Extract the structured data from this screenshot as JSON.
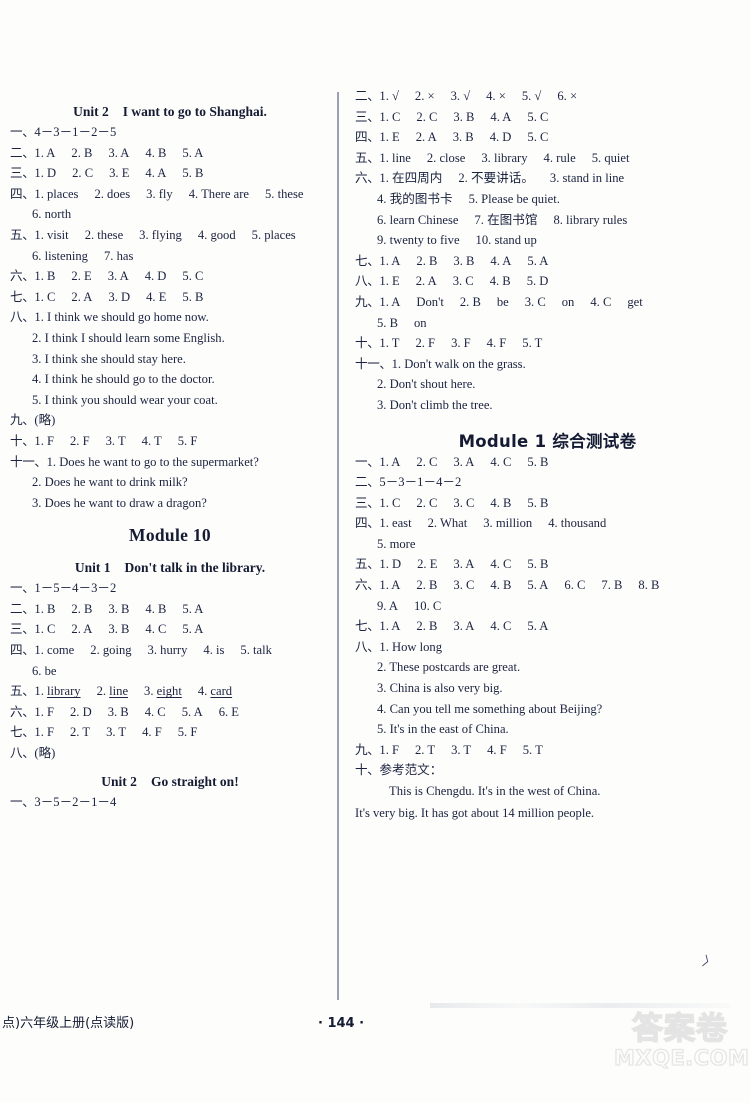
{
  "page": {
    "number": "· 144 ·",
    "footer_note": "点)六年级上册(点读版)",
    "watermark_cjk": "答案卷",
    "watermark_domain": "MXQE.COM",
    "edge_mark": "〉"
  },
  "left_column": {
    "unit2_title_num": "Unit 2",
    "unit2_title_text": "I want to go to Shanghai.",
    "unit2_answers": [
      {
        "idx": "一、",
        "body": "4－3－1－2－5"
      },
      {
        "idx": "二、",
        "body": "1. A   2. B   3. A   4. B   5. A"
      },
      {
        "idx": "三、",
        "body": "1. D   2. C   3. E   4. A   5. B"
      },
      {
        "idx": "四、",
        "body": "1. places   2. does   3. fly   4. There are   5. these"
      },
      {
        "idx": "",
        "body": "6. north",
        "continuation": true
      },
      {
        "idx": "五、",
        "body": "1. visit   2. these   3. flying   4. good   5. places"
      },
      {
        "idx": "",
        "body": "6. listening   7. has",
        "continuation": true
      },
      {
        "idx": "六、",
        "body": "1. B   2. E   3. A   4. D   5. C"
      },
      {
        "idx": "七、",
        "body": "1. C   2. A   3. D   4. E   5. B"
      },
      {
        "idx": "八、",
        "body": "1. I think we should go home now."
      },
      {
        "idx": "",
        "body": "2. I think I should learn some English.",
        "continuation": true
      },
      {
        "idx": "",
        "body": "3. I think she should stay here.",
        "continuation": true
      },
      {
        "idx": "",
        "body": "4. I think he should go to the doctor.",
        "continuation": true
      },
      {
        "idx": "",
        "body": "5. I think you should wear your coat.",
        "continuation": true
      },
      {
        "idx": "九、",
        "body": "(略)"
      },
      {
        "idx": "十、",
        "body": "1. F   2. F   3. T   4. T   5. F"
      },
      {
        "idx": "十一、",
        "body": "1. Does he want to go to the supermarket?"
      },
      {
        "idx": "",
        "body": "2. Does he want to drink milk?",
        "continuation": true
      },
      {
        "idx": "",
        "body": "3. Does he want to draw a dragon?",
        "continuation": true
      }
    ],
    "module10_title": "Module 10",
    "unit1_title_num": "Unit 1",
    "unit1_title_text": "Don't talk in the library.",
    "unit1_answers": [
      {
        "idx": "一、",
        "body": "1－5－4－3－2"
      },
      {
        "idx": "二、",
        "body": "1. B   2. B   3. B   4. B   5. A"
      },
      {
        "idx": "三、",
        "body": "1. C   2. A   3. B   4. C   5. A"
      },
      {
        "idx": "四、",
        "body": "1. come   2. going   3. hurry   4. is   5. talk"
      },
      {
        "idx": "",
        "body": "6. be",
        "continuation": true
      },
      {
        "idx": "五、",
        "body": "1. library   2. line   3. eight   4. card",
        "underlined": true
      },
      {
        "idx": "六、",
        "body": "1. F   2. D   3. B   4. C   5. A   6. E"
      },
      {
        "idx": "七、",
        "body": "1. F   2. T   3. T   4. F   5. F"
      },
      {
        "idx": "八、",
        "body": "(略)"
      }
    ],
    "unit2b_title_num": "Unit 2",
    "unit2b_title_text": "Go straight on!",
    "unit2b_answers": [
      {
        "idx": "一、",
        "body": "3－5－2－1－4"
      }
    ]
  },
  "right_column": {
    "unit2b_answers_cont": [
      {
        "idx": "二、",
        "body": "1. √   2. ×   3. √   4. ×   5. √   6. ×"
      },
      {
        "idx": "三、",
        "body": "1. C   2. C   3. B   4. A   5. C"
      },
      {
        "idx": "四、",
        "body": "1. E   2. A   3. B   4. D   5. C"
      },
      {
        "idx": "五、",
        "body": "1. line   2. close   3. library   4. rule   5. quiet"
      },
      {
        "idx": "六、",
        "body": "1. 在四周内   2. 不要讲话。   3. stand in line"
      },
      {
        "idx": "",
        "body": "4. 我的图书卡   5. Please be quiet.",
        "continuation": true
      },
      {
        "idx": "",
        "body": "6. learn Chinese   7. 在图书馆   8. library rules",
        "continuation": true
      },
      {
        "idx": "",
        "body": "9. twenty to five   10. stand up",
        "continuation": true
      },
      {
        "idx": "七、",
        "body": "1. A   2. B   3. B   4. A   5. A"
      },
      {
        "idx": "八、",
        "body": "1. E   2. A   3. C   4. B   5. D"
      },
      {
        "idx": "九、",
        "body": "1. A   Don't   2. B   be   3. C   on   4. C   get"
      },
      {
        "idx": "",
        "body": "5. B   on",
        "continuation": true
      },
      {
        "idx": "十、",
        "body": "1. T   2. F   3. F   4. F   5. T"
      },
      {
        "idx": "十一、",
        "body": "1. Don't walk on the grass."
      },
      {
        "idx": "",
        "body": "2. Don't shout here.",
        "continuation": true
      },
      {
        "idx": "",
        "body": "3. Don't climb the tree.",
        "continuation": true
      }
    ],
    "module1_title": "Module 1 综合测试卷",
    "module1_answers": [
      {
        "idx": "一、",
        "body": "1. A   2. C   3. A   4. C   5. B"
      },
      {
        "idx": "二、",
        "body": "5－3－1－4－2"
      },
      {
        "idx": "三、",
        "body": "1. C   2. C   3. C   4. B   5. B"
      },
      {
        "idx": "四、",
        "body": "1. east   2. What   3. million   4. thousand"
      },
      {
        "idx": "",
        "body": "5. more",
        "continuation": true
      },
      {
        "idx": "五、",
        "body": "1. D   2. E   3. A   4. C   5. B"
      },
      {
        "idx": "六、",
        "body": "1. A   2. B   3. C   4. B   5. A   6. C   7. B   8. B"
      },
      {
        "idx": "",
        "body": "9. A   10. C",
        "continuation": true
      },
      {
        "idx": "七、",
        "body": "1. A   2. B   3. A   4. C   5. A"
      },
      {
        "idx": "八、",
        "body": "1. How long"
      },
      {
        "idx": "",
        "body": "2. These postcards are great.",
        "continuation": true
      },
      {
        "idx": "",
        "body": "3. China is also very big.",
        "continuation": true
      },
      {
        "idx": "",
        "body": "4. Can you tell me something about Beijing?",
        "continuation": true
      },
      {
        "idx": "",
        "body": "5. It's in the east of China.",
        "continuation": true
      },
      {
        "idx": "九、",
        "body": "1. F   2. T   3. T   4. F   5. T"
      },
      {
        "idx": "十、",
        "body": "参考范文：",
        "cjk": true
      }
    ],
    "module1_essay": [
      "This is Chengdu.  It's in the west of China.",
      "It's very big.  It has got about 14 million people."
    ]
  }
}
